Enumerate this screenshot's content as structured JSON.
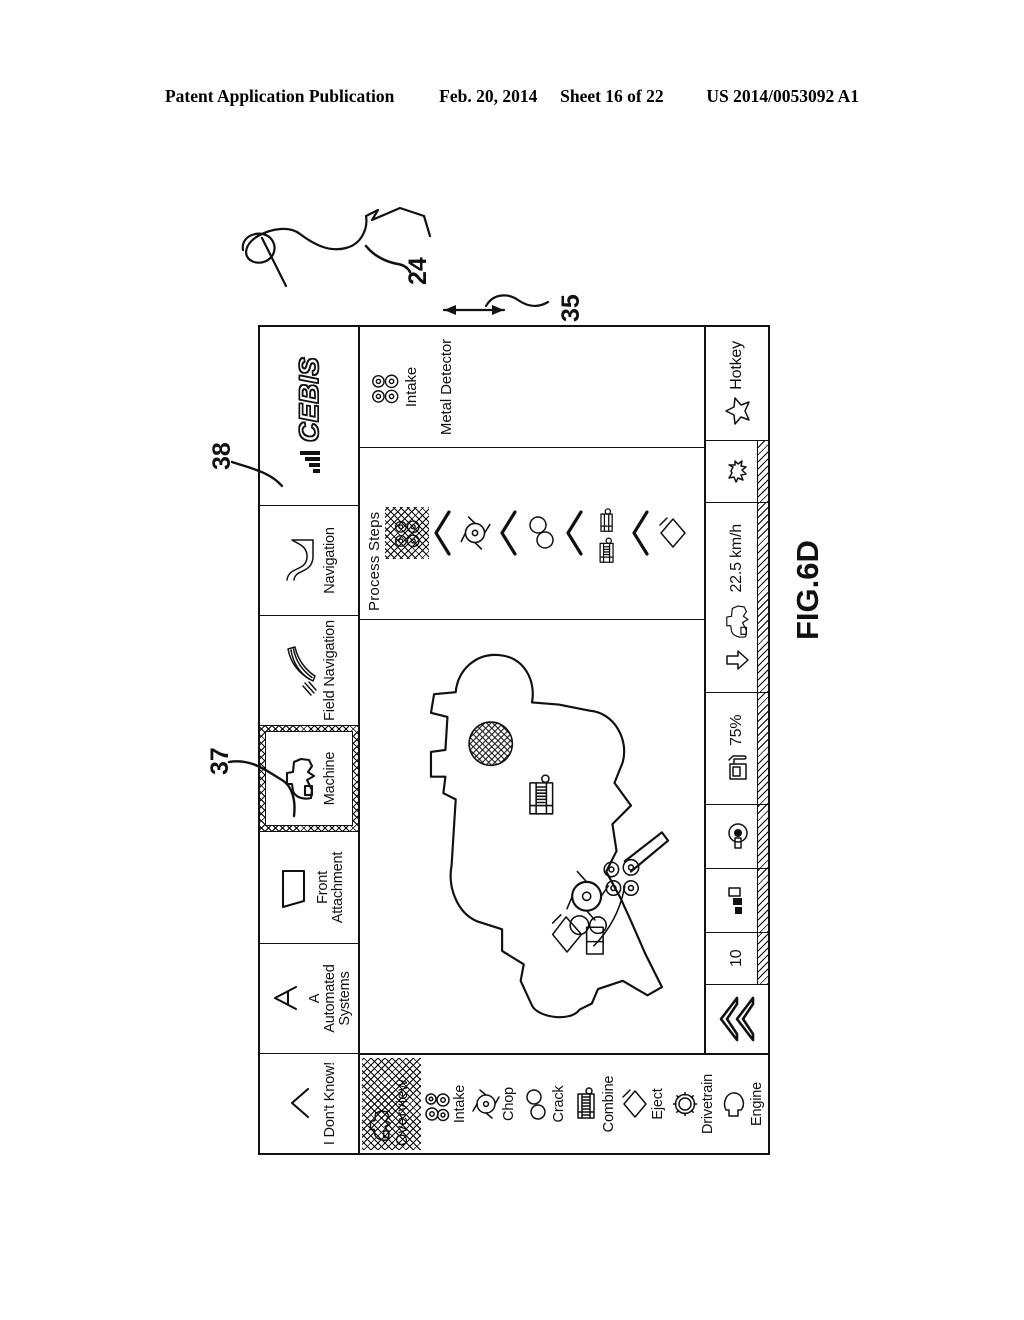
{
  "patent_header": {
    "publication": "Patent Application Publication",
    "date": "Feb. 20, 2014",
    "sheet": "Sheet 16 of 22",
    "number": "US 2014/0053092 A1"
  },
  "figure": {
    "label": "FIG.6D",
    "reference_numerals": [
      {
        "id": "24",
        "text": "24"
      },
      {
        "id": "35",
        "text": "35"
      },
      {
        "id": "37",
        "text": "37"
      },
      {
        "id": "38",
        "text": "38"
      }
    ]
  },
  "screen": {
    "topbar": {
      "items": [
        {
          "label": "I Don't Know!",
          "icon": "chevron-up-icon",
          "selected": false
        },
        {
          "label": "A\nAutomated\nSystems",
          "icon": "letter-a-icon",
          "selected": false
        },
        {
          "label": "Front\nAttachment",
          "icon": "header-attachment-icon",
          "selected": false
        },
        {
          "label": "Machine",
          "icon": "combine-harvester-icon",
          "selected": true
        },
        {
          "label": "Field Navigation",
          "icon": "field-stripes-icon",
          "selected": false
        },
        {
          "label": "Navigation",
          "icon": "route-curve-icon",
          "selected": false
        },
        {
          "label": "CEBIS",
          "icon": "signal-bars-icon",
          "selected": false
        }
      ]
    },
    "sidebar": {
      "items": [
        {
          "label": "Overview",
          "icon": "combine-harvester-icon",
          "selected": true
        },
        {
          "label": "Intake",
          "icon": "four-rollers-icon",
          "selected": false
        },
        {
          "label": "Chop",
          "icon": "chopper-drum-icon",
          "selected": false
        },
        {
          "label": "Crack",
          "icon": "two-circles-icon",
          "selected": false
        },
        {
          "label": "Combine",
          "icon": "conditioner-icon",
          "selected": false
        },
        {
          "label": "Eject",
          "icon": "diamond-blower-icon",
          "selected": false
        },
        {
          "label": "Drivetrain",
          "icon": "gear-icon",
          "selected": false
        },
        {
          "label": "Engine",
          "icon": "engine-icon",
          "selected": false
        }
      ]
    },
    "process_steps": {
      "title": "Process Steps",
      "steps": [
        {
          "label": "Intake",
          "icon": "four-rollers-icon",
          "selected": true
        },
        {
          "label": "Chop",
          "icon": "chopper-drum-icon",
          "selected": false
        },
        {
          "label": "Crack",
          "icon": "two-circles-icon",
          "selected": false
        },
        {
          "label": "Combine",
          "icon": "conditioner-icon",
          "selected": false
        },
        {
          "label": "Eject",
          "icon": "diamond-blower-icon",
          "selected": false
        }
      ]
    },
    "detail_panel": {
      "icon": "four-rollers-icon",
      "label_primary": "Intake",
      "label_secondary": "Metal Detector"
    },
    "collapse_control": {
      "icon": "double-chevron-up-icon"
    },
    "statusbar": {
      "brightness": {
        "icon": "sun-icon",
        "value": ""
      },
      "speed": {
        "icon": "machine-speed-icon",
        "value": "22.5 km/h"
      },
      "fuel": {
        "icon": "fuel-pump-icon",
        "value": "75%"
      },
      "temperature": {
        "icon": "thermometer-icon",
        "value": ""
      },
      "battery": {
        "icon": "battery-icon",
        "value": ""
      },
      "counter": {
        "icon": "",
        "value": "10"
      },
      "hotkey": {
        "icon": "star-icon",
        "label": "Hotkey"
      }
    }
  }
}
